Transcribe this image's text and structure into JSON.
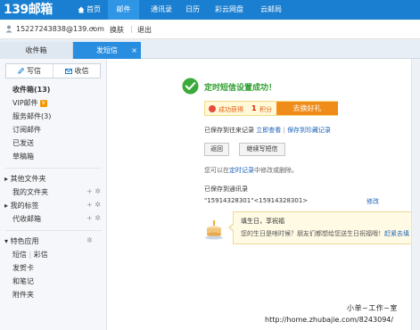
{
  "brand": {
    "logo_text": "139邮箱"
  },
  "topnav": {
    "items": [
      {
        "label": "首页",
        "icon": "home-icon"
      },
      {
        "label": "邮件",
        "active": true
      },
      {
        "label": "通讯录"
      },
      {
        "label": "日历"
      },
      {
        "label": "彩云网盘"
      },
      {
        "label": "云邮局"
      }
    ],
    "bg_color": "#1a7fd0"
  },
  "userbar": {
    "email": "15227243838@139.com",
    "arrow": "▾",
    "switch_label": "换肤",
    "separator": "|",
    "logout_label": "退出"
  },
  "tabs": {
    "inbox_label": "收件箱",
    "sms_label": "发短信",
    "close_glyph": "×"
  },
  "sidebar": {
    "write_label": "写信",
    "receive_label": "收信",
    "folders": [
      {
        "label": "收件箱(13)",
        "bold": true
      },
      {
        "label": "VIP邮件",
        "badge": "V"
      },
      {
        "label": "服务邮件(3)"
      },
      {
        "label": "订阅邮件"
      },
      {
        "label": "已发送"
      },
      {
        "label": "草稿箱"
      }
    ],
    "other_folders_label": "其他文件夹",
    "my_folders_label": "我的文件夹",
    "my_tags_label": "我的标签",
    "proxy_mail_label": "代收邮箱",
    "features_label": "特色应用",
    "sms_label": "短信",
    "mms_label": "彩信",
    "feature_sep": "|",
    "greeting_card_label": "发贺卡",
    "notes_label": "和笔记",
    "attachments_label": "附件夹",
    "add_glyph": "+",
    "gear_glyph": "✲"
  },
  "main": {
    "success_title": "定时短信设置成功！",
    "reward_text": "成功获得",
    "reward_points": "1",
    "reward_unit": "积分",
    "redeem_label": "去换好礼",
    "saved_text": "已保存到往来记录",
    "view_now_label": "立即查看",
    "separator": "|",
    "saved_to_link": "保存到珍藏记录",
    "back_label": "返回",
    "continue_label": "继续写短信",
    "modify_prefix": "您可以在",
    "modify_link": "定时记录",
    "modify_suffix": "中修改或删除。",
    "addr_label": "已保存到通讯录",
    "addr_value": "\"15914328301\"<15914328301>",
    "addr_edit_label": "修改",
    "bubble_title": "填生日，享祝福",
    "bubble_text": "您的生日是啥时候？朋友们都想给您送生日祝福哦！",
    "bubble_link": "赶紧去填"
  },
  "watermark": {
    "line1": "小单~工作~室",
    "line2": "http://home.zhubajie.com/8243094/"
  },
  "colors": {
    "success_green": "#2f9e2f",
    "accent_blue": "#2a8ee0",
    "orange": "#f08c1a",
    "link_blue": "#1a62b8"
  }
}
